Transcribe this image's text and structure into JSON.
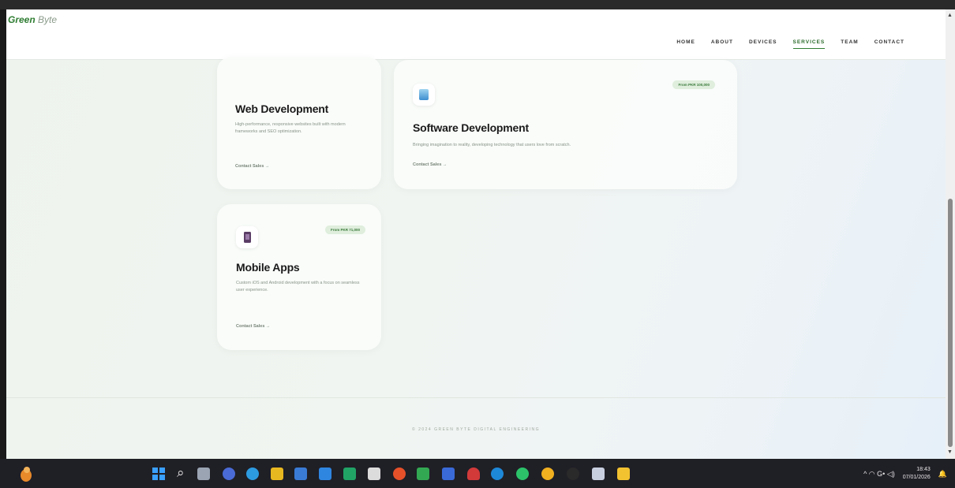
{
  "brand": {
    "bold": "Green",
    "light": "Byte"
  },
  "nav": {
    "items": [
      {
        "label": "HOME",
        "active": false
      },
      {
        "label": "ABOUT",
        "active": false
      },
      {
        "label": "DEVICES",
        "active": false
      },
      {
        "label": "SERVICES",
        "active": true
      },
      {
        "label": "TEAM",
        "active": false
      },
      {
        "label": "CONTACT",
        "active": false
      }
    ]
  },
  "cards": {
    "web": {
      "title": "Web Development",
      "desc": "High-performance, responsive websites built with modern frameworks and SEO optimization.",
      "link": "Contact Sales →"
    },
    "software": {
      "title": "Software Development",
      "desc": "Bringing imagination to reality, developing technology that users love from scratch.",
      "link": "Contact Sales →",
      "price": "From PKR 100,000"
    },
    "mobile": {
      "title": "Mobile Apps",
      "desc": "Custom iOS and Android development with a focus on seamless user experience.",
      "link": "Contact Sales →",
      "price": "From PKR 71,000"
    }
  },
  "footer": {
    "text": "© 2024 GREEN BYTE DIGITAL ENGINEERING"
  },
  "taskbar": {
    "time": "18:43",
    "date": "07/01/2026",
    "tray": "^  ◠  G•  ◁)"
  },
  "colors": {
    "accent": "#2f7d32",
    "badge_bg": "#dfeedd",
    "taskbar": "#1f1f26"
  }
}
